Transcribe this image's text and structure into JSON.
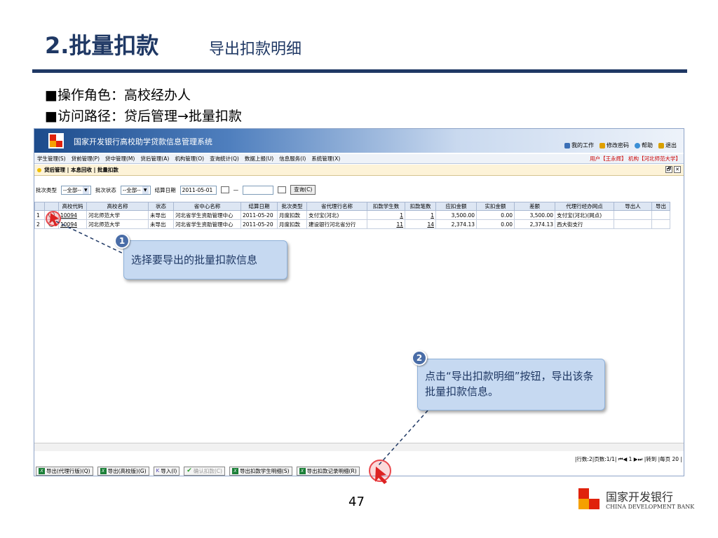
{
  "slide": {
    "title": "2.批量扣款",
    "subtitle": "导出扣款明细",
    "bullets": [
      "■操作角色：高校经办人",
      "■访问路径：贷后管理→批量扣款"
    ],
    "page_number": "47"
  },
  "app": {
    "title": "国家开发银行高校助学贷款信息管理系统",
    "toplinks": [
      "我的工作",
      "修改密码",
      "帮助",
      "退出"
    ],
    "user_info": "用户【王永辉】 机构【河北师范大学】",
    "menu": [
      "学生管理(S)",
      "贷前管理(P)",
      "贷中管理(M)",
      "贷后管理(A)",
      "机构管理(O)",
      "查询统计(Q)",
      "数据上报(U)",
      "信息服务(I)",
      "系统管理(X)"
    ],
    "breadcrumb": "贷后管理 | 本息回收 | 批量扣款",
    "window_buttons": [
      "🗗",
      "✕"
    ],
    "filter": {
      "batch_type_label": "批次类型",
      "batch_type_value": "--全部--",
      "batch_status_label": "批次状态",
      "batch_status_value": "--全部--",
      "settle_date_label": "结算日期",
      "settle_date_from": "2011-05-01",
      "dash": "—",
      "query_button": "查询(C)"
    },
    "table": {
      "columns": [
        "",
        "",
        "高校代码",
        "高校名称",
        "状态",
        "省中心名称",
        "结算日期",
        "批次类型",
        "省代理行名称",
        "扣款学生数",
        "扣款笔数",
        "应扣金额",
        "实扣金额",
        "差额",
        "代理行经办网点",
        "导出人",
        "导出"
      ],
      "rows": [
        [
          "1",
          "",
          "10094",
          "河北师范大学",
          "未导出",
          "河北省学生资助管理中心",
          "2011-05-20",
          "月度扣款",
          "支付宝(河北)",
          "1",
          "1",
          "3,500.00",
          "0.00",
          "3,500.00",
          "支付宝(河北)(网点)",
          "",
          ""
        ],
        [
          "2",
          "",
          "10094",
          "河北师范大学",
          "未导出",
          "河北省学生资助管理中心",
          "2011-05-20",
          "月度扣款",
          "建设银行河北省分行",
          "11",
          "14",
          "2,374.13",
          "0.00",
          "2,374.13",
          "西大街支行",
          "",
          ""
        ]
      ]
    },
    "pager": "|行数:2|页数:1/1| ⏮◀ 1 ▶⏭ |转到 |每页 20 |",
    "bottom_buttons": [
      "导出(代理行版)(Q)",
      "导出(高校版)(G)",
      "导入(I)",
      "确认扣款(C)",
      "导出扣款学生明细(S)",
      "导出扣款记录明细(R)"
    ]
  },
  "callouts": [
    {
      "badge": "1",
      "text": "选择要导出的批量扣款信息"
    },
    {
      "badge": "2",
      "text": "点击“导出扣款明细”按钮，导出该条批量扣款信息。"
    }
  ],
  "bank": {
    "name_cn": "国家开发银行",
    "name_en": "CHINA DEVELOPMENT BANK"
  },
  "colors": {
    "title": "#1f3864",
    "accent_red": "#e0220c",
    "callout_bg": "#c6d9f1",
    "highlight": "#e9484d"
  }
}
